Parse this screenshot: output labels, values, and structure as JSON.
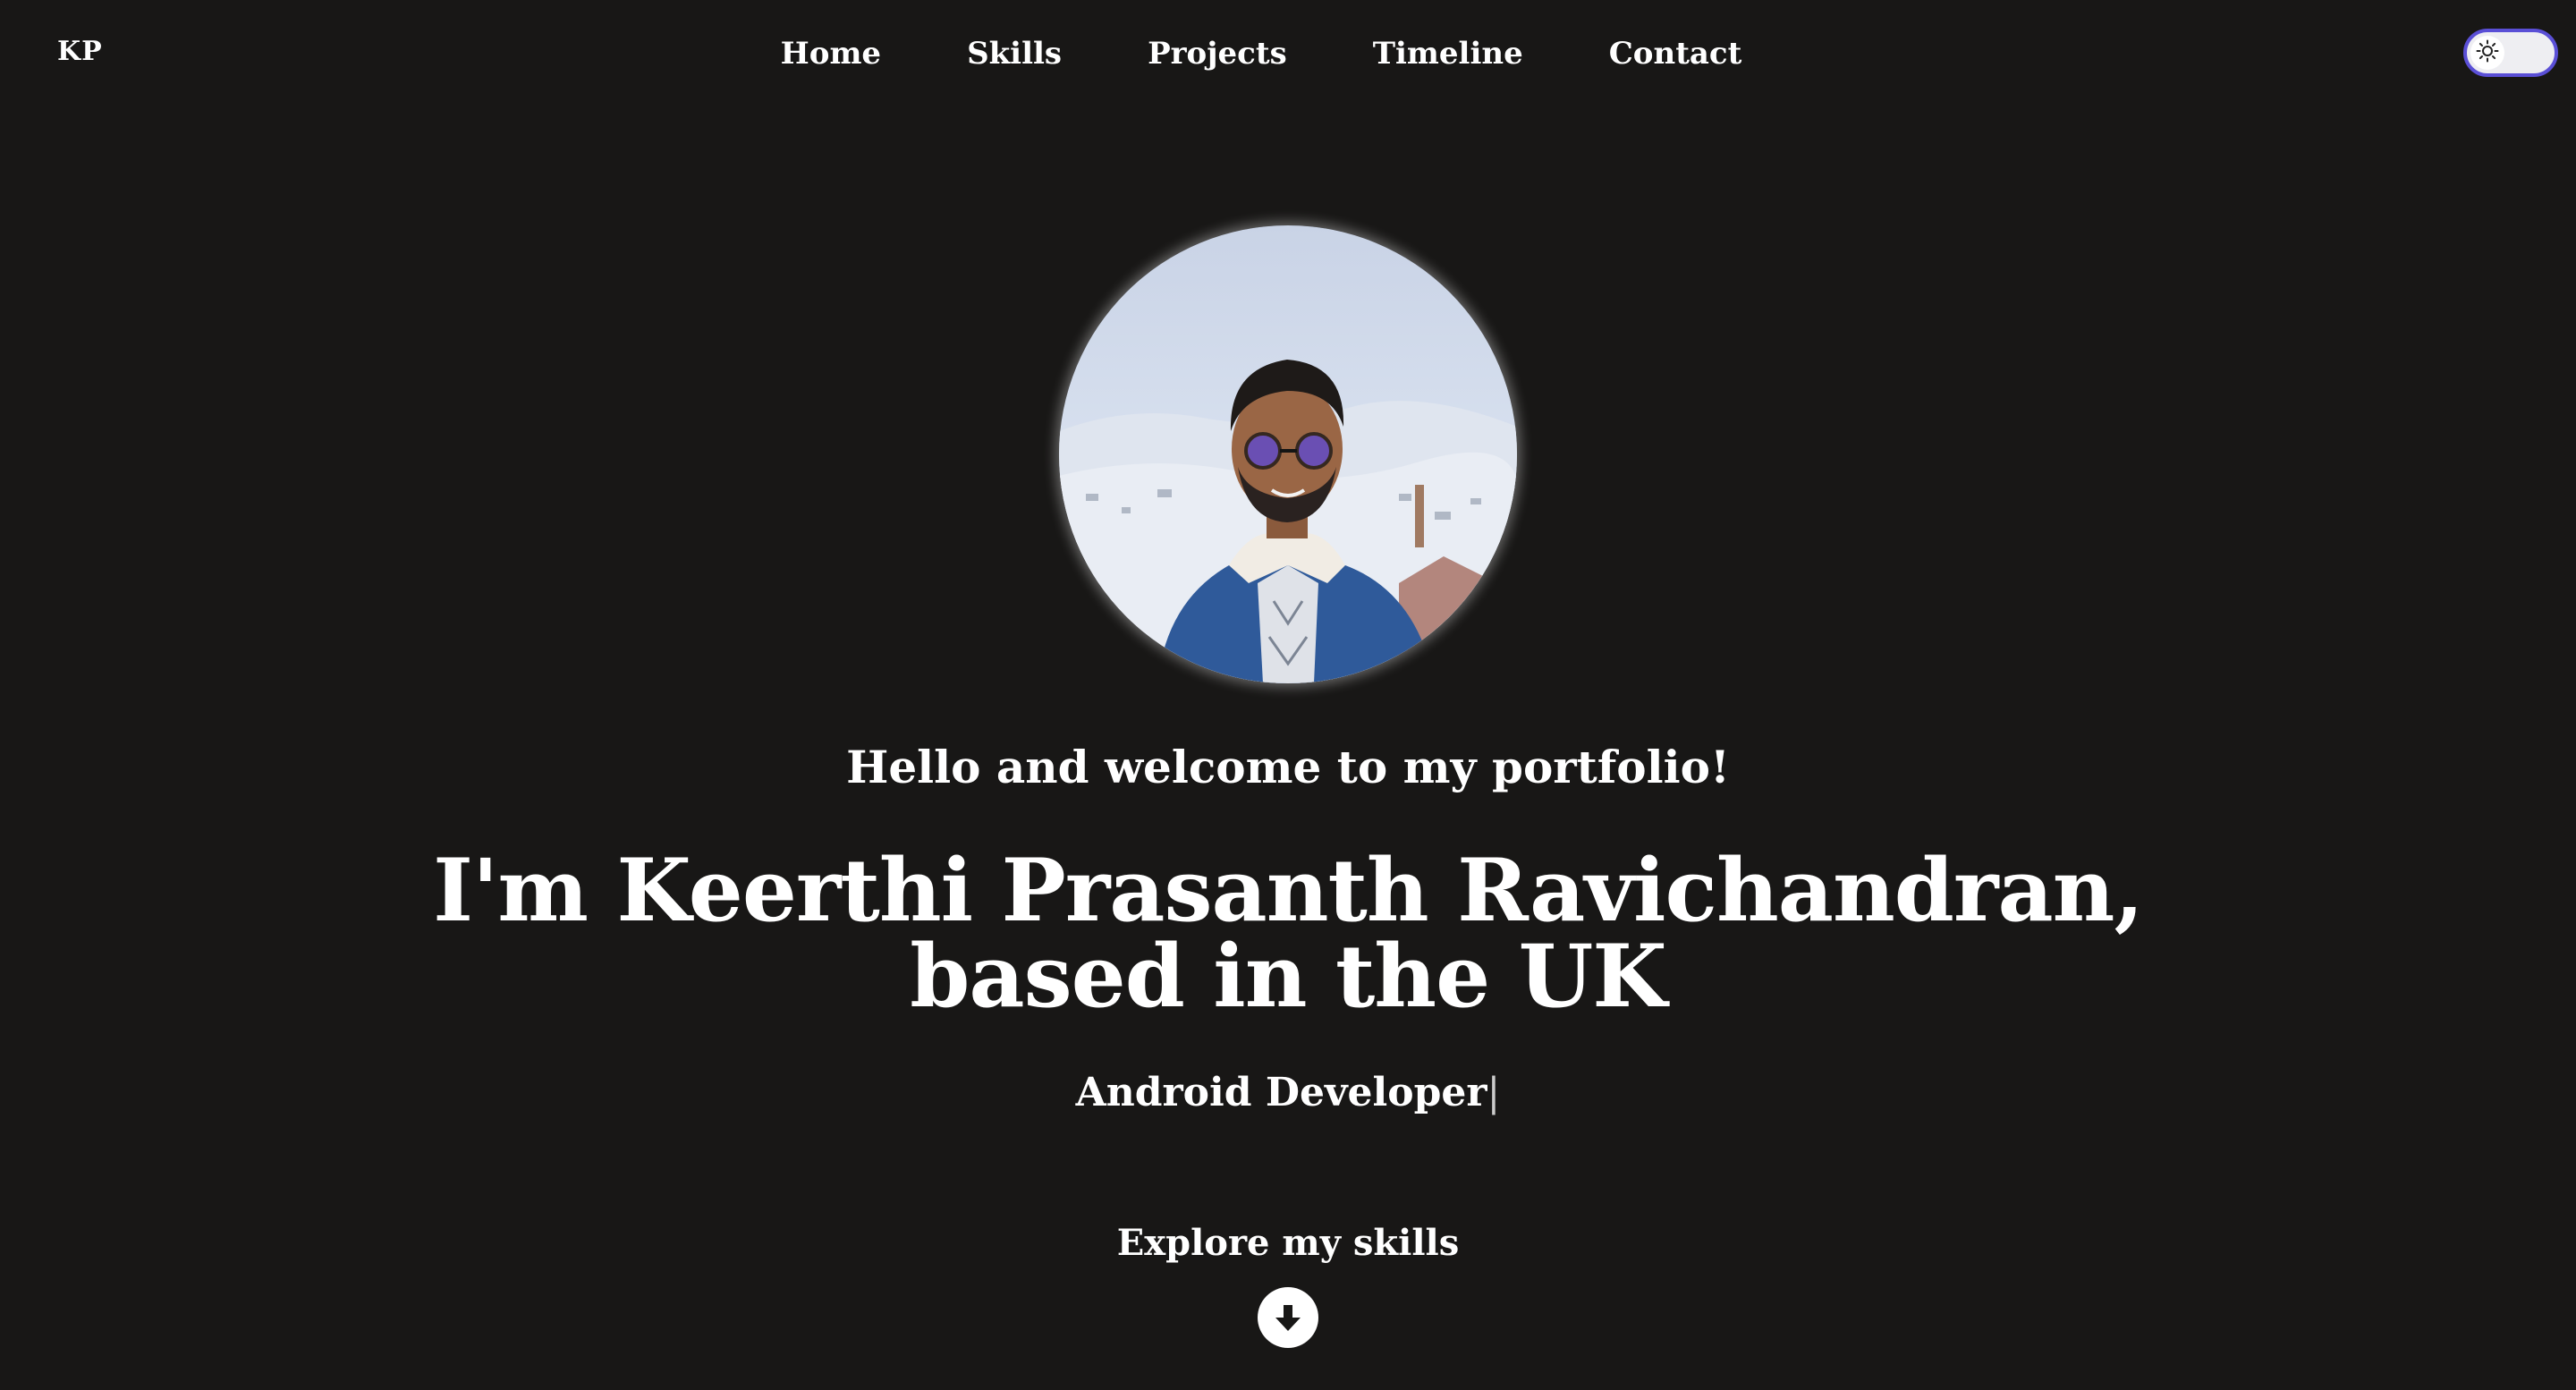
{
  "header": {
    "logo": "KP",
    "nav": [
      {
        "label": "Home"
      },
      {
        "label": "Skills"
      },
      {
        "label": "Projects"
      },
      {
        "label": "Timeline"
      },
      {
        "label": "Contact"
      }
    ],
    "theme_toggle_icon": "sun-icon"
  },
  "hero": {
    "avatar_alt": "profile-photo",
    "greeting": "Hello and welcome to my portfolio!",
    "headline_line1": "I'm Keerthi Prasanth Ravichandran,",
    "headline_line2": "based in the UK",
    "role": "Android Developer",
    "cursor": "|",
    "explore_label": "Explore my skills",
    "explore_icon": "arrow-down-circle-icon"
  },
  "colors": {
    "background": "#181716",
    "text": "#ffffff",
    "toggle_border": "#5a4fd6"
  }
}
